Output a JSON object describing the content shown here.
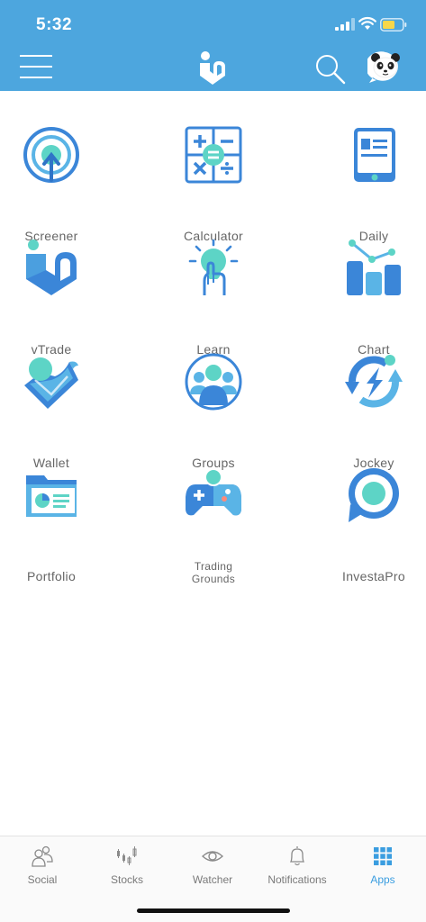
{
  "status_bar": {
    "time": "5:32"
  },
  "colors": {
    "header": "#4da6de",
    "accent": "#3a9de0",
    "teal": "#5dd4c6",
    "blue": "#3b86d8"
  },
  "header": {
    "menu_icon": "hamburger-menu-icon",
    "logo_icon": "brand-logo-icon",
    "search_icon": "search-icon",
    "avatar_icon": "panda-avatar-icon"
  },
  "apps": [
    {
      "label": "Screener",
      "icon": "target-arrow-icon"
    },
    {
      "label": "Calculator",
      "icon": "calculator-icon"
    },
    {
      "label": "Daily",
      "icon": "document-icon"
    },
    {
      "label": "vTrade",
      "icon": "vtrade-logo-icon"
    },
    {
      "label": "Learn",
      "icon": "lightbulb-hand-icon"
    },
    {
      "label": "Chart",
      "icon": "bar-chart-icon"
    },
    {
      "label": "Wallet",
      "icon": "wallet-icon"
    },
    {
      "label": "Groups",
      "icon": "group-people-icon"
    },
    {
      "label": "Jockey",
      "icon": "lightning-cycle-icon"
    },
    {
      "label": "Portfolio",
      "icon": "folder-chart-icon"
    },
    {
      "label": "Trading Grounds",
      "line1": "Trading",
      "line2": "Grounds",
      "icon": "gamepad-icon"
    },
    {
      "label": "InvestaPro",
      "icon": "investapro-ring-icon"
    }
  ],
  "tabs": [
    {
      "label": "Social",
      "icon": "people-icon",
      "active": false
    },
    {
      "label": "Stocks",
      "icon": "candlestick-icon",
      "active": false
    },
    {
      "label": "Watcher",
      "icon": "eye-icon",
      "active": false
    },
    {
      "label": "Notifications",
      "icon": "bell-icon",
      "active": false
    },
    {
      "label": "Apps",
      "icon": "apps-grid-icon",
      "active": true
    }
  ]
}
